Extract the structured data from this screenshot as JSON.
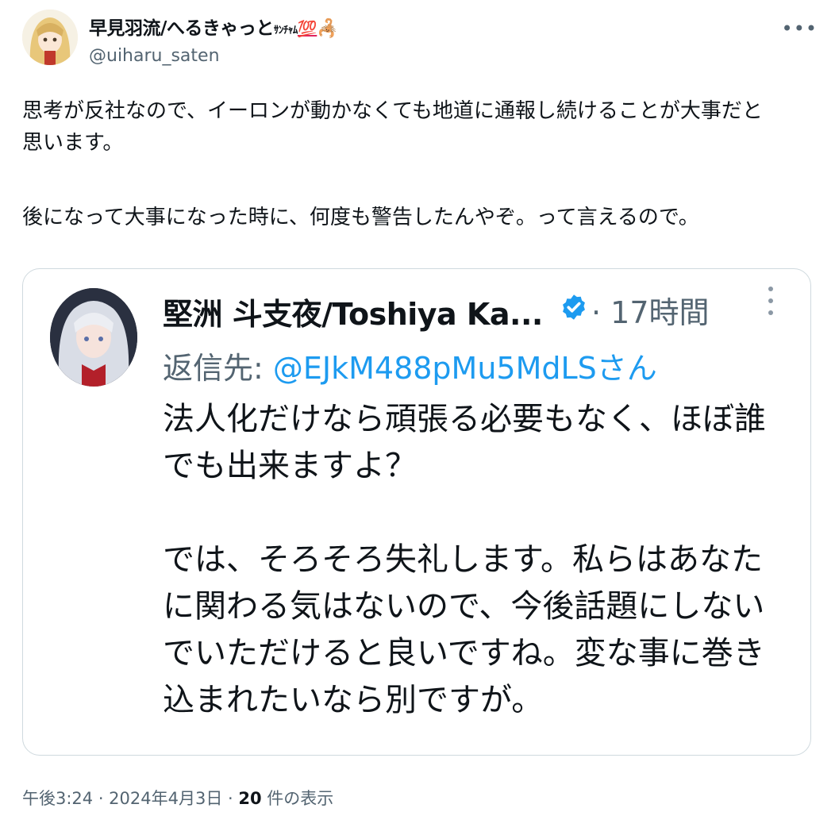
{
  "author": {
    "display_name": "早見羽流/へるきゃっと",
    "name_suffix": "ｻﾝﾁｬﾑ",
    "emoji_hundred": "💯",
    "emoji_scorpion": "🦂",
    "handle": "@uiharu_saten"
  },
  "tweet": {
    "lines": [
      "思考が反社なので、イーロンが動かなくても地道に通報し続けることが大事だと",
      "思います。",
      "後になって大事になった時に、何度も警告したんやぞ。って言えるので。"
    ]
  },
  "quote": {
    "display_name": "堅洲 斗支夜/Toshiya Ka...",
    "time": "· 17時間",
    "reply_prefix": "返信先: ",
    "reply_handle": "@EJkM488pMu5MdLSさん",
    "lines": [
      "法人化だけなら頑張る必要もなく、ほぼ誰",
      "でも出来ますよ？",
      "では、そろそろ失礼します。私らはあなた",
      "に関わる気はないので、今後話題にしない",
      "でいただけると良いですね。変な事に巻き",
      "込まれたいなら別ですが。"
    ]
  },
  "meta": {
    "timestamp": "午後3:24 · 2024年4月3日 · ",
    "views_count": "20",
    "views_label": " 件の表示"
  },
  "icons": {
    "more_top": "more-horizontal-icon",
    "more_quote": "more-vertical-icon",
    "verified": "verified-badge-icon"
  },
  "colors": {
    "text": "#0f1419",
    "secondary": "#536471",
    "link": "#1d9bf0",
    "border": "#cfd9de"
  }
}
